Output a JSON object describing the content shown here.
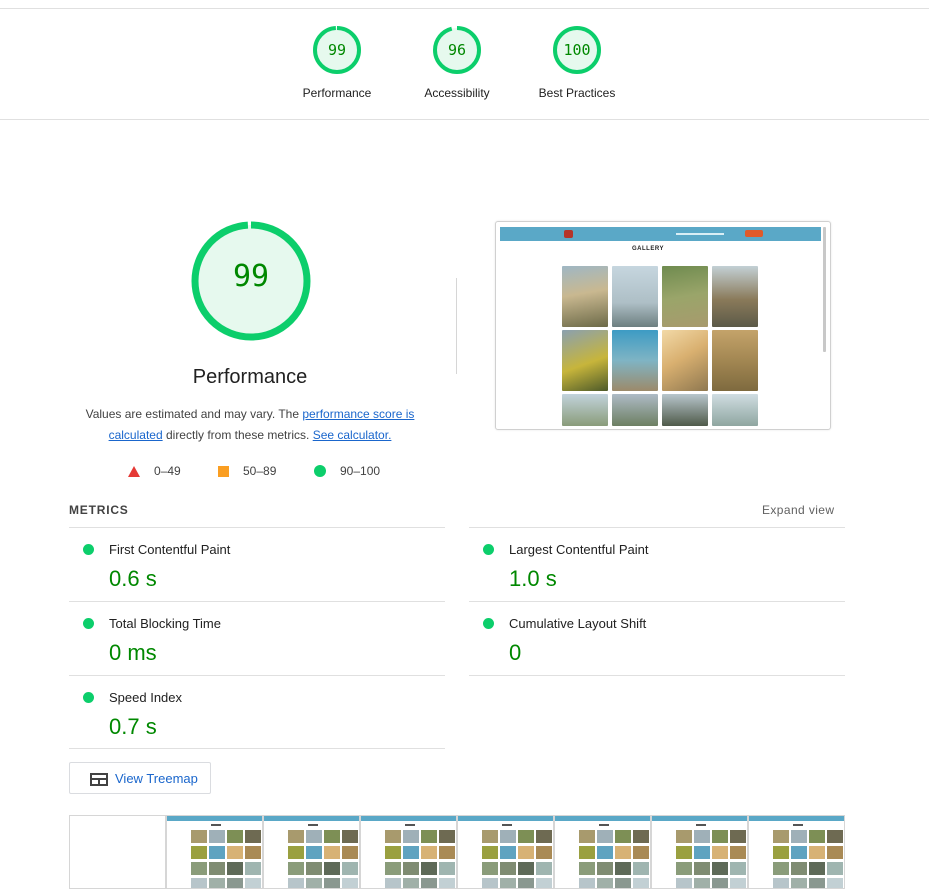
{
  "summary": {
    "categories": [
      {
        "label": "Performance",
        "score": "99",
        "fraction": 0.99
      },
      {
        "label": "Accessibility",
        "score": "96",
        "fraction": 0.96
      },
      {
        "label": "Best Practices",
        "score": "100",
        "fraction": 1.0
      }
    ]
  },
  "performance": {
    "score": "99",
    "fraction": 0.99,
    "title": "Performance",
    "desc_prefix": "Values are estimated and may vary. The ",
    "link_score": "performance score is calculated",
    "desc_middle": " directly from these metrics. ",
    "link_calc": "See calculator."
  },
  "legend": [
    {
      "icon": "red-triangle-icon",
      "range": "0–49"
    },
    {
      "icon": "orange-square-icon",
      "range": "50–89"
    },
    {
      "icon": "green-circle-icon",
      "range": "90–100"
    }
  ],
  "screenshot": {
    "title": "GALLERY"
  },
  "metrics": {
    "heading": "METRICS",
    "expand_label": "Expand view",
    "items": [
      {
        "name": "First Contentful Paint",
        "value": "0.6 s"
      },
      {
        "name": "Largest Contentful Paint",
        "value": "1.0 s"
      },
      {
        "name": "Total Blocking Time",
        "value": "0 ms"
      },
      {
        "name": "Cumulative Layout Shift",
        "value": "0"
      },
      {
        "name": "Speed Index",
        "value": "0.7 s"
      }
    ]
  },
  "treemap": {
    "label": "View Treemap",
    "icon": "treemap-icon"
  },
  "colors": {
    "pass": "#0cce6b",
    "pass_text": "#008800",
    "pass_fill": "#e6f9ee",
    "average": "#fa9e22",
    "fail": "#e53935",
    "link": "#1a66cc",
    "header": "#5aa8c7"
  }
}
